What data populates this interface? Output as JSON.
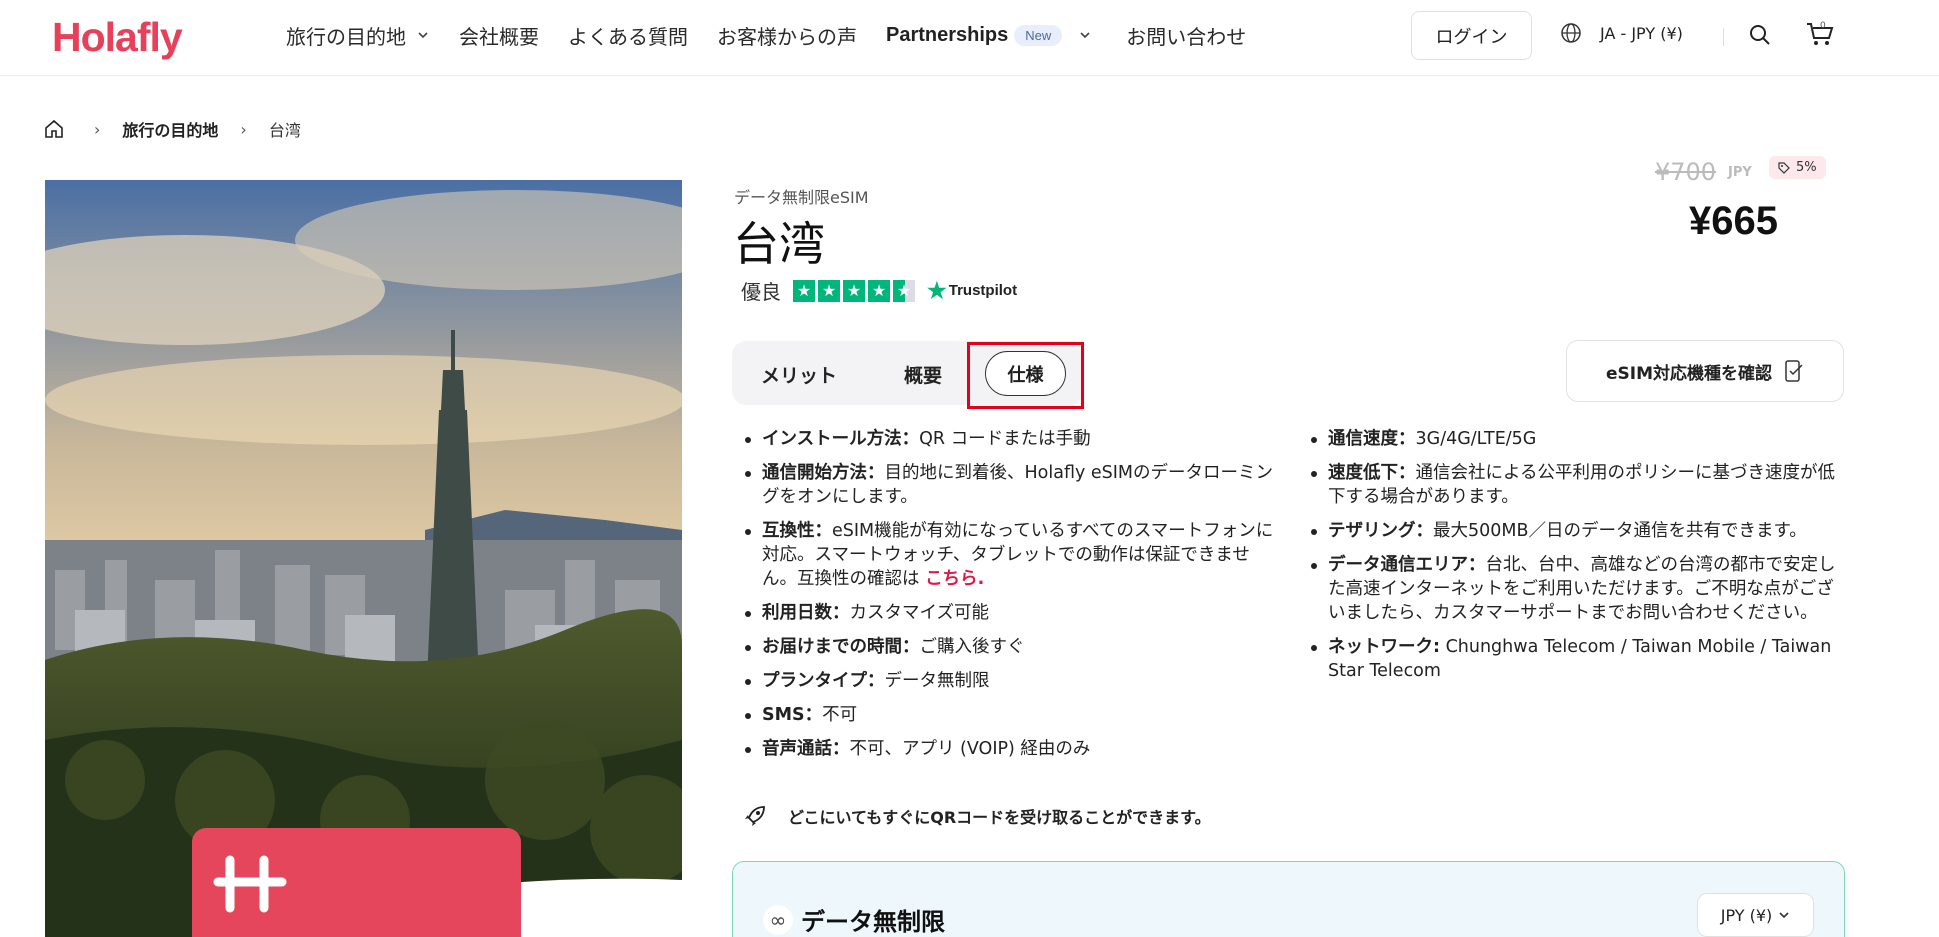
{
  "header": {
    "logo": "Holafly",
    "nav": [
      {
        "label": "旅行の目的地",
        "has_dropdown": true
      },
      {
        "label": "会社概要"
      },
      {
        "label": "よくある質問"
      },
      {
        "label": "お客様からの声"
      },
      {
        "label": "Partnerships",
        "badge": "New",
        "has_dropdown": true
      },
      {
        "label": "お問い合わせ"
      }
    ],
    "login": "ログイン",
    "language": "JA - JPY (¥)",
    "cart_count": "0"
  },
  "breadcrumb": {
    "home_icon": "home-icon",
    "items": [
      "旅行の目的地",
      "台湾"
    ]
  },
  "product": {
    "subtitle": "データ無制限eSIM",
    "title": "台湾",
    "rating_label": "優良",
    "rating_stars": 4.5,
    "rating_source": "Trustpilot",
    "old_price": "¥700",
    "currency": "JPY",
    "discount": "5%",
    "price": "¥665"
  },
  "tabs": {
    "merit": "メリット",
    "overview": "概要",
    "spec": "仕様",
    "active": "spec"
  },
  "check_button": "eSIM対応機種を確認",
  "specs_left": [
    {
      "label": "インストール方法：",
      "value": "QR コードまたは手動"
    },
    {
      "label": "通信開始方法：",
      "value": "目的地に到着後、Holafly eSIMのデータローミングをオンにします。"
    },
    {
      "label": "互換性：",
      "value": "eSIM機能が有効になっているすべてのスマートフォンに対応。スマートウォッチ、タブレットでの動作は保証できません。互換性の確認は ",
      "link": "こちら",
      "after": "."
    },
    {
      "label": "利用日数：",
      "value": "カスタマイズ可能"
    },
    {
      "label": "お届けまでの時間：",
      "value": "ご購入後すぐ"
    },
    {
      "label": "プランタイプ：",
      "value": "データ無制限"
    },
    {
      "label": "SMS：",
      "value": "不可"
    },
    {
      "label": "音声通話：",
      "value": "不可、アプリ (VOIP) 経由のみ"
    }
  ],
  "specs_right": [
    {
      "label": "通信速度：",
      "value": "3G/4G/LTE/5G"
    },
    {
      "label": "速度低下：",
      "value": "通信会社による公平利用のポリシーに基づき速度が低下する場合があります。"
    },
    {
      "label": "テザリング：",
      "value": "最大500MB／日のデータ通信を共有できます。"
    },
    {
      "label": "データ通信エリア：",
      "value": "台北、台中、高雄などの台湾の都市で安定した高速インターネットをご利用いただけます。ご不明な点がございましたら、カスタマーサポートまでお問い合わせください。"
    },
    {
      "label": "ネットワーク:",
      "value": " Chunghwa Telecom / Taiwan Mobile / Taiwan Star Telecom"
    }
  ],
  "qr_note": "どこにいてもすぐにQRコードを受け取ることができます。",
  "plan": {
    "title": "データ無制限",
    "currency_select": "JPY (¥)"
  },
  "colors": {
    "brand": "#e6405a",
    "trustpilot": "#00b67a",
    "highlight": "#e3001b"
  }
}
